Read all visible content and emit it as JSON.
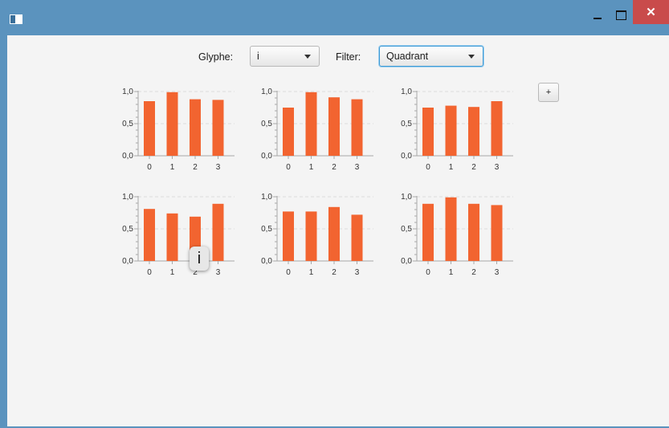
{
  "window": {
    "title": "",
    "colors": {
      "titlebar": "#5b93be",
      "close": "#c94b4b",
      "client": "#f4f4f4"
    },
    "controls": {
      "minimize_glyph": "",
      "maximize_glyph": "",
      "close_glyph": "✕"
    }
  },
  "toolbar": {
    "glyph_label": "Glyphe:",
    "glyph_value": "i",
    "filter_label": "Filter:",
    "filter_value": "Quadrant",
    "add_label": "+"
  },
  "tooltip": {
    "text": "i"
  },
  "chart_data": [
    {
      "type": "bar",
      "categories": [
        "0",
        "1",
        "2",
        "3"
      ],
      "values": [
        0.85,
        0.99,
        0.88,
        0.87
      ],
      "ylim": [
        0,
        1
      ],
      "yticks": [
        "0,0",
        "0,5",
        "1,0"
      ],
      "color": "#f26430"
    },
    {
      "type": "bar",
      "categories": [
        "0",
        "1",
        "2",
        "3"
      ],
      "values": [
        0.75,
        0.99,
        0.91,
        0.88
      ],
      "ylim": [
        0,
        1
      ],
      "yticks": [
        "0,0",
        "0,5",
        "1,0"
      ],
      "color": "#f26430"
    },
    {
      "type": "bar",
      "categories": [
        "0",
        "1",
        "2",
        "3"
      ],
      "values": [
        0.75,
        0.78,
        0.76,
        0.85
      ],
      "ylim": [
        0,
        1
      ],
      "yticks": [
        "0,0",
        "0,5",
        "1,0"
      ],
      "color": "#f26430"
    },
    {
      "type": "bar",
      "categories": [
        "0",
        "1",
        "2",
        "3"
      ],
      "values": [
        0.81,
        0.74,
        0.69,
        0.89
      ],
      "ylim": [
        0,
        1
      ],
      "yticks": [
        "0,0",
        "0,5",
        "1,0"
      ],
      "color": "#f26430"
    },
    {
      "type": "bar",
      "categories": [
        "0",
        "1",
        "2",
        "3"
      ],
      "values": [
        0.77,
        0.77,
        0.84,
        0.72
      ],
      "ylim": [
        0,
        1
      ],
      "yticks": [
        "0,0",
        "0,5",
        "1,0"
      ],
      "color": "#f26430"
    },
    {
      "type": "bar",
      "categories": [
        "0",
        "1",
        "2",
        "3"
      ],
      "values": [
        0.89,
        0.99,
        0.89,
        0.87
      ],
      "ylim": [
        0,
        1
      ],
      "yticks": [
        "0,0",
        "0,5",
        "1,0"
      ],
      "color": "#f26430"
    }
  ]
}
